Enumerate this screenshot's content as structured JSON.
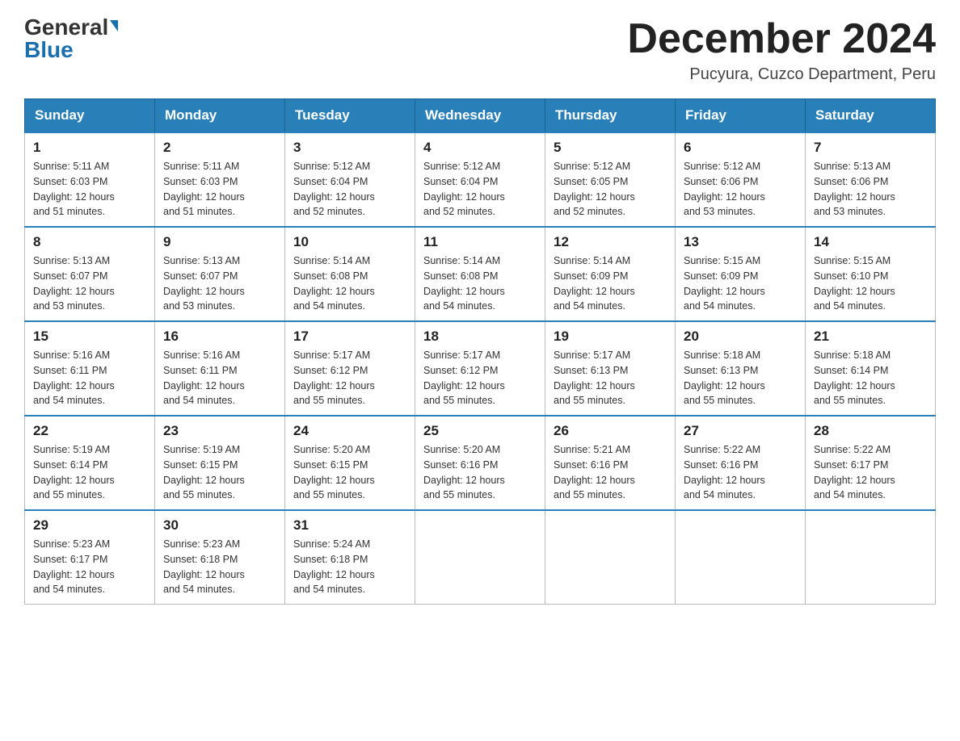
{
  "header": {
    "logo_general": "General",
    "logo_blue": "Blue",
    "title": "December 2024",
    "location": "Pucyura, Cuzco Department, Peru"
  },
  "days_of_week": [
    "Sunday",
    "Monday",
    "Tuesday",
    "Wednesday",
    "Thursday",
    "Friday",
    "Saturday"
  ],
  "weeks": [
    [
      {
        "day": "1",
        "sunrise": "5:11 AM",
        "sunset": "6:03 PM",
        "daylight": "12 hours and 51 minutes."
      },
      {
        "day": "2",
        "sunrise": "5:11 AM",
        "sunset": "6:03 PM",
        "daylight": "12 hours and 51 minutes."
      },
      {
        "day": "3",
        "sunrise": "5:12 AM",
        "sunset": "6:04 PM",
        "daylight": "12 hours and 52 minutes."
      },
      {
        "day": "4",
        "sunrise": "5:12 AM",
        "sunset": "6:04 PM",
        "daylight": "12 hours and 52 minutes."
      },
      {
        "day": "5",
        "sunrise": "5:12 AM",
        "sunset": "6:05 PM",
        "daylight": "12 hours and 52 minutes."
      },
      {
        "day": "6",
        "sunrise": "5:12 AM",
        "sunset": "6:06 PM",
        "daylight": "12 hours and 53 minutes."
      },
      {
        "day": "7",
        "sunrise": "5:13 AM",
        "sunset": "6:06 PM",
        "daylight": "12 hours and 53 minutes."
      }
    ],
    [
      {
        "day": "8",
        "sunrise": "5:13 AM",
        "sunset": "6:07 PM",
        "daylight": "12 hours and 53 minutes."
      },
      {
        "day": "9",
        "sunrise": "5:13 AM",
        "sunset": "6:07 PM",
        "daylight": "12 hours and 53 minutes."
      },
      {
        "day": "10",
        "sunrise": "5:14 AM",
        "sunset": "6:08 PM",
        "daylight": "12 hours and 54 minutes."
      },
      {
        "day": "11",
        "sunrise": "5:14 AM",
        "sunset": "6:08 PM",
        "daylight": "12 hours and 54 minutes."
      },
      {
        "day": "12",
        "sunrise": "5:14 AM",
        "sunset": "6:09 PM",
        "daylight": "12 hours and 54 minutes."
      },
      {
        "day": "13",
        "sunrise": "5:15 AM",
        "sunset": "6:09 PM",
        "daylight": "12 hours and 54 minutes."
      },
      {
        "day": "14",
        "sunrise": "5:15 AM",
        "sunset": "6:10 PM",
        "daylight": "12 hours and 54 minutes."
      }
    ],
    [
      {
        "day": "15",
        "sunrise": "5:16 AM",
        "sunset": "6:11 PM",
        "daylight": "12 hours and 54 minutes."
      },
      {
        "day": "16",
        "sunrise": "5:16 AM",
        "sunset": "6:11 PM",
        "daylight": "12 hours and 54 minutes."
      },
      {
        "day": "17",
        "sunrise": "5:17 AM",
        "sunset": "6:12 PM",
        "daylight": "12 hours and 55 minutes."
      },
      {
        "day": "18",
        "sunrise": "5:17 AM",
        "sunset": "6:12 PM",
        "daylight": "12 hours and 55 minutes."
      },
      {
        "day": "19",
        "sunrise": "5:17 AM",
        "sunset": "6:13 PM",
        "daylight": "12 hours and 55 minutes."
      },
      {
        "day": "20",
        "sunrise": "5:18 AM",
        "sunset": "6:13 PM",
        "daylight": "12 hours and 55 minutes."
      },
      {
        "day": "21",
        "sunrise": "5:18 AM",
        "sunset": "6:14 PM",
        "daylight": "12 hours and 55 minutes."
      }
    ],
    [
      {
        "day": "22",
        "sunrise": "5:19 AM",
        "sunset": "6:14 PM",
        "daylight": "12 hours and 55 minutes."
      },
      {
        "day": "23",
        "sunrise": "5:19 AM",
        "sunset": "6:15 PM",
        "daylight": "12 hours and 55 minutes."
      },
      {
        "day": "24",
        "sunrise": "5:20 AM",
        "sunset": "6:15 PM",
        "daylight": "12 hours and 55 minutes."
      },
      {
        "day": "25",
        "sunrise": "5:20 AM",
        "sunset": "6:16 PM",
        "daylight": "12 hours and 55 minutes."
      },
      {
        "day": "26",
        "sunrise": "5:21 AM",
        "sunset": "6:16 PM",
        "daylight": "12 hours and 55 minutes."
      },
      {
        "day": "27",
        "sunrise": "5:22 AM",
        "sunset": "6:16 PM",
        "daylight": "12 hours and 54 minutes."
      },
      {
        "day": "28",
        "sunrise": "5:22 AM",
        "sunset": "6:17 PM",
        "daylight": "12 hours and 54 minutes."
      }
    ],
    [
      {
        "day": "29",
        "sunrise": "5:23 AM",
        "sunset": "6:17 PM",
        "daylight": "12 hours and 54 minutes."
      },
      {
        "day": "30",
        "sunrise": "5:23 AM",
        "sunset": "6:18 PM",
        "daylight": "12 hours and 54 minutes."
      },
      {
        "day": "31",
        "sunrise": "5:24 AM",
        "sunset": "6:18 PM",
        "daylight": "12 hours and 54 minutes."
      },
      null,
      null,
      null,
      null
    ]
  ],
  "labels": {
    "sunrise": "Sunrise:",
    "sunset": "Sunset:",
    "daylight": "Daylight:"
  }
}
